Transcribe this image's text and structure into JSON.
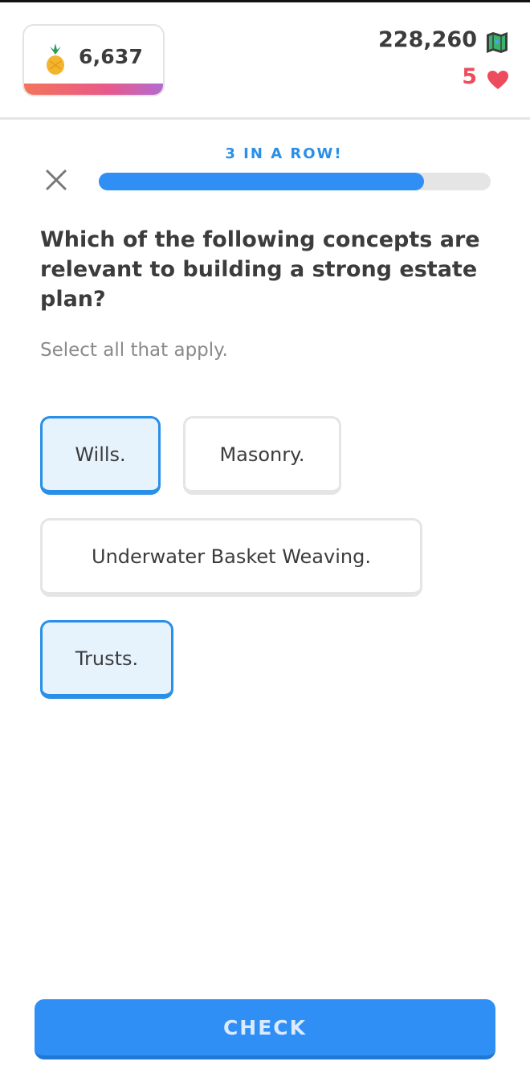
{
  "header": {
    "pineapple_count": "6,637",
    "pineapple_progress": 1.0,
    "map_count": "228,260",
    "lives_count": "5"
  },
  "lesson": {
    "streak_label": "3 IN A ROW!",
    "progress": 0.83
  },
  "question": {
    "text": "Which of the following concepts are relevant to building a strong estate plan?",
    "instruction": "Select all that apply."
  },
  "options": [
    {
      "label": "Wills.",
      "selected": true
    },
    {
      "label": "Masonry.",
      "selected": false
    },
    {
      "label": "Underwater Basket Weaving.",
      "selected": false
    },
    {
      "label": "Trusts.",
      "selected": true
    }
  ],
  "footer": {
    "check_label": "CHECK"
  },
  "colors": {
    "accent": "#2f8ff5",
    "selected_border": "#2a8fe6",
    "selected_fill": "#e6f3fd",
    "hearts": "#ec4c5c"
  },
  "icons": {
    "pineapple": "pineapple-icon",
    "map": "map-icon",
    "heart": "heart-icon",
    "close": "close-icon"
  }
}
